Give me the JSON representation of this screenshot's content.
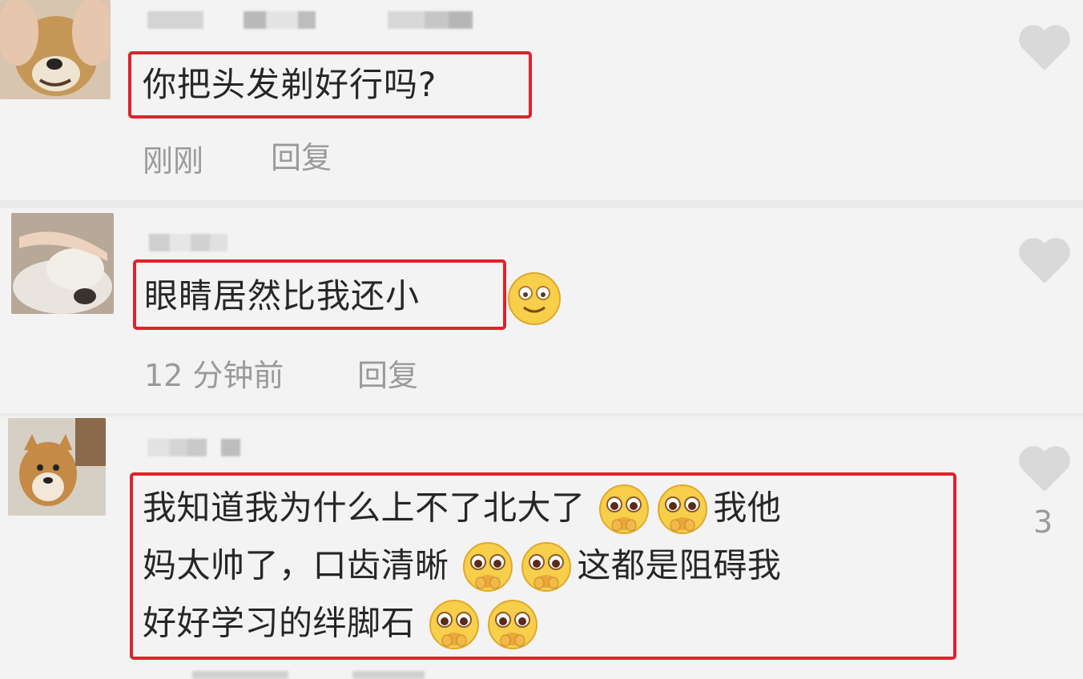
{
  "comments": [
    {
      "text": "你把头发剃好行吗?",
      "time": "刚刚",
      "reply_label": "回复",
      "likes": ""
    },
    {
      "text": "眼睛居然比我还小",
      "time": "12 分钟前",
      "reply_label": "回复",
      "likes": ""
    },
    {
      "text_line1a": "我知道我为什么上不了北大了",
      "text_line1b": "我他",
      "text_line2a": "妈太帅了，口齿清晰",
      "text_line2b": "这都是阻碍我",
      "text_line3a": "好好学习的绊脚石",
      "time": "",
      "reply_label": "",
      "likes": "3"
    }
  ],
  "icons": {
    "like": "heart-icon",
    "emoji_smile": "smile-emoji-icon",
    "emoji_plead": "pleading-emoji-icon"
  },
  "colors": {
    "highlight_border": "#e0222a",
    "heart": "#d9d9d9",
    "meta_text": "#9a9a9a"
  }
}
